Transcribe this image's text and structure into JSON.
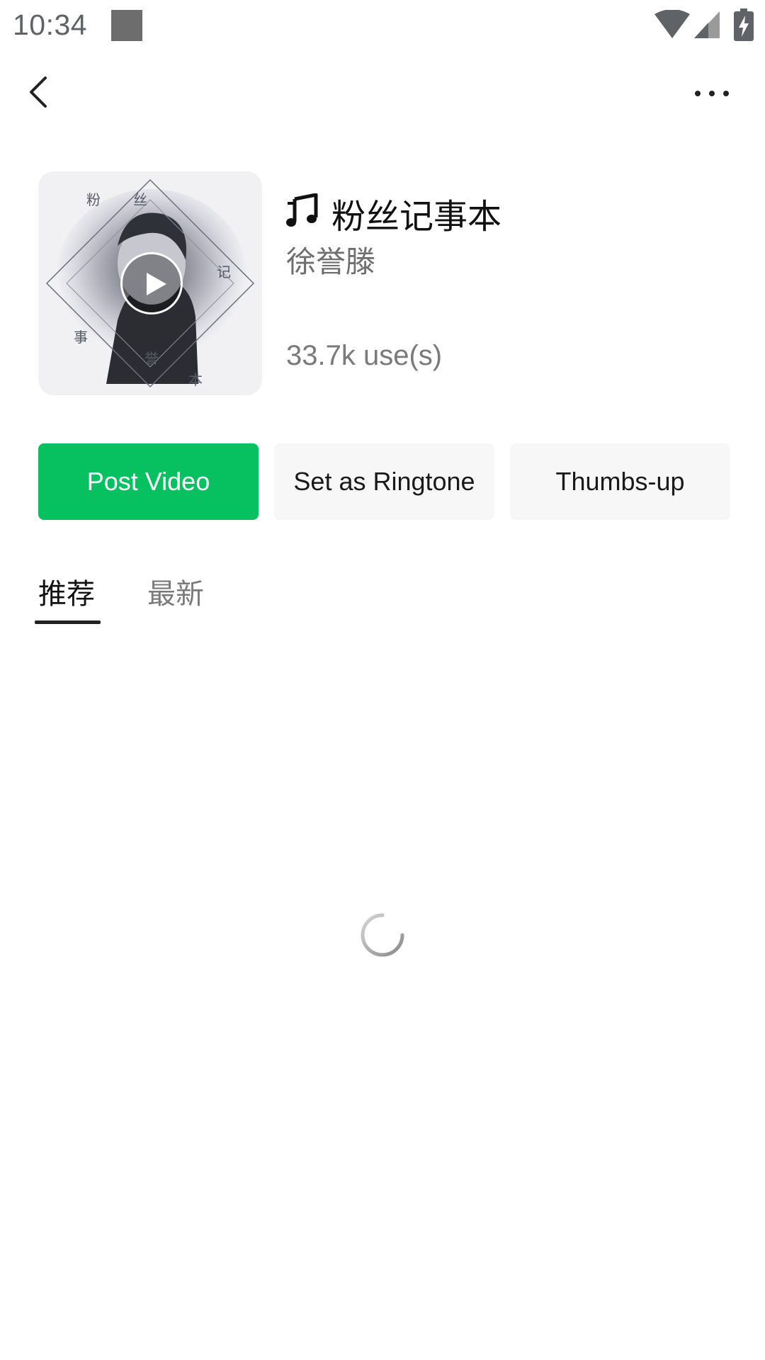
{
  "status_bar": {
    "time": "10:34",
    "icons": [
      "notification-square-icon",
      "wifi-icon",
      "cell-signal-icon",
      "battery-charging-icon"
    ]
  },
  "toolbar": {
    "back_icon": "chevron-left-icon",
    "more_icon": "more-horizontal-icon"
  },
  "song": {
    "icon": "music-note-icon",
    "title": "粉丝记事本",
    "artist": "徐誉滕",
    "usage": "33.7k use(s)",
    "cover_characters": [
      "粉",
      "丝",
      "记",
      "事",
      "誉",
      "本"
    ],
    "play_icon": "play-icon"
  },
  "actions": {
    "post_video": "Post Video",
    "set_ringtone": "Set as Ringtone",
    "thumbs_up": "Thumbs-up"
  },
  "tabs": [
    {
      "label": "推荐",
      "selected": true
    },
    {
      "label": "最新",
      "selected": false
    }
  ],
  "loading_icon": "loading-spinner-icon",
  "colors": {
    "accent": "#07c160",
    "secondary_button": "#f7f7f7",
    "text_primary": "#111111",
    "text_secondary": "#7a7a7a"
  }
}
